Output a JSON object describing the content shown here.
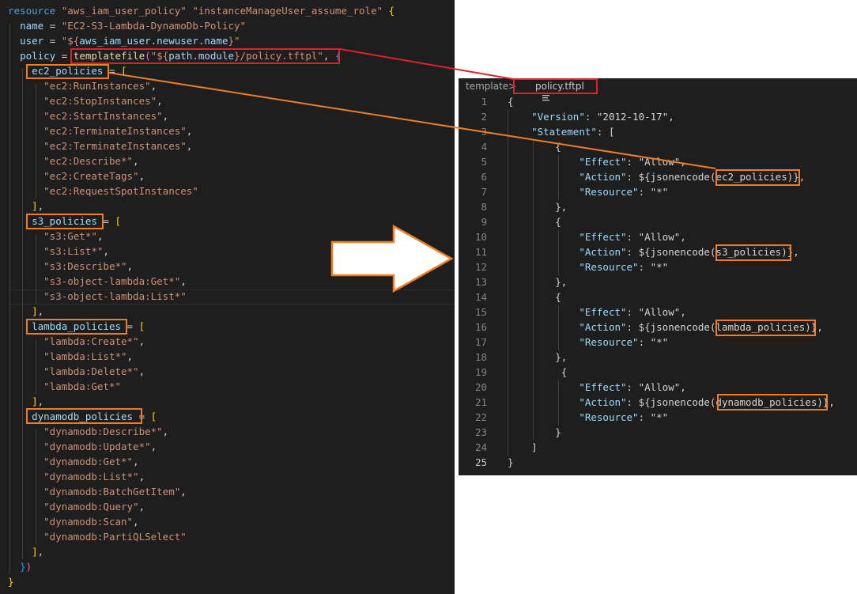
{
  "left_editor": {
    "lines": [
      [
        [
          "kw",
          "resource "
        ],
        [
          "s",
          "\"aws_iam_user_policy\" "
        ],
        [
          "s",
          "\"instanceManageUser_assume_role\" "
        ],
        [
          "p1",
          "{"
        ]
      ],
      [
        [
          "pl",
          "  "
        ],
        [
          "k",
          "name"
        ],
        [
          "pl",
          " = "
        ],
        [
          "s",
          "\"EC2-S3-Lambda-DynamoDb-Policy\""
        ]
      ],
      [
        [
          "pl",
          "  "
        ],
        [
          "k",
          "user"
        ],
        [
          "pl",
          " = "
        ],
        [
          "s",
          "\"${"
        ],
        [
          "k",
          "aws_iam_user.newuser.name"
        ],
        [
          "s",
          "}\""
        ]
      ],
      [
        [
          "pl",
          "  "
        ],
        [
          "k",
          "policy"
        ],
        [
          "pl",
          " = "
        ],
        [
          "fn",
          "templatefile"
        ],
        [
          "p2",
          "("
        ],
        [
          "s",
          "\"${"
        ],
        [
          "k",
          "path.module"
        ],
        [
          "s",
          "}/policy.tftpl\""
        ],
        [
          "pl",
          ", "
        ],
        [
          "p3",
          "{"
        ]
      ],
      [
        [
          "pl",
          "    "
        ],
        [
          "k",
          "ec2_policies"
        ],
        [
          "pl",
          " = "
        ],
        [
          "p1",
          "["
        ]
      ],
      [
        [
          "pl",
          "      "
        ],
        [
          "s",
          "\"ec2:RunInstances\""
        ],
        [
          "pl",
          ","
        ]
      ],
      [
        [
          "pl",
          "      "
        ],
        [
          "s",
          "\"ec2:StopInstances\""
        ],
        [
          "pl",
          ","
        ]
      ],
      [
        [
          "pl",
          "      "
        ],
        [
          "s",
          "\"ec2:StartInstances\""
        ],
        [
          "pl",
          ","
        ]
      ],
      [
        [
          "pl",
          "      "
        ],
        [
          "s",
          "\"ec2:TerminateInstances\""
        ],
        [
          "pl",
          ","
        ]
      ],
      [
        [
          "pl",
          "      "
        ],
        [
          "s",
          "\"ec2:TerminateInstances\""
        ],
        [
          "pl",
          ","
        ]
      ],
      [
        [
          "pl",
          "      "
        ],
        [
          "s",
          "\"ec2:Describe*\""
        ],
        [
          "pl",
          ","
        ]
      ],
      [
        [
          "pl",
          "      "
        ],
        [
          "s",
          "\"ec2:CreateTags\""
        ],
        [
          "pl",
          ","
        ]
      ],
      [
        [
          "pl",
          "      "
        ],
        [
          "s",
          "\"ec2:RequestSpotInstances\""
        ]
      ],
      [
        [
          "pl",
          "    "
        ],
        [
          "p1",
          "]"
        ],
        [
          "pl",
          ","
        ]
      ],
      [
        [
          "pl",
          "    "
        ],
        [
          "k",
          "s3_policies"
        ],
        [
          "pl",
          " = "
        ],
        [
          "p1",
          "["
        ]
      ],
      [
        [
          "pl",
          "      "
        ],
        [
          "s",
          "\"s3:Get*\""
        ],
        [
          "pl",
          ","
        ]
      ],
      [
        [
          "pl",
          "      "
        ],
        [
          "s",
          "\"s3:List*\""
        ],
        [
          "pl",
          ","
        ]
      ],
      [
        [
          "pl",
          "      "
        ],
        [
          "s",
          "\"s3:Describe*\""
        ],
        [
          "pl",
          ","
        ]
      ],
      [
        [
          "pl",
          "      "
        ],
        [
          "s",
          "\"s3-object-lambda:Get*\""
        ],
        [
          "pl",
          ","
        ]
      ],
      [
        [
          "pl",
          "      "
        ],
        [
          "s",
          "\"s3-object-lambda:List*\""
        ]
      ],
      [
        [
          "pl",
          "    "
        ],
        [
          "p1",
          "]"
        ],
        [
          "pl",
          ","
        ]
      ],
      [
        [
          "pl",
          "    "
        ],
        [
          "k",
          "lambda_policies"
        ],
        [
          "pl",
          " = "
        ],
        [
          "p1",
          "["
        ]
      ],
      [
        [
          "pl",
          "      "
        ],
        [
          "s",
          "\"lambda:Create*\""
        ],
        [
          "pl",
          ","
        ]
      ],
      [
        [
          "pl",
          "      "
        ],
        [
          "s",
          "\"lambda:List*\""
        ],
        [
          "pl",
          ","
        ]
      ],
      [
        [
          "pl",
          "      "
        ],
        [
          "s",
          "\"lambda:Delete*\""
        ],
        [
          "pl",
          ","
        ]
      ],
      [
        [
          "pl",
          "      "
        ],
        [
          "s",
          "\"lambda:Get*\""
        ]
      ],
      [
        [
          "pl",
          "    "
        ],
        [
          "p1",
          "]"
        ],
        [
          "pl",
          ","
        ]
      ],
      [
        [
          "pl",
          "    "
        ],
        [
          "k",
          "dynamodb_policies"
        ],
        [
          "pl",
          " = "
        ],
        [
          "p1",
          "["
        ]
      ],
      [
        [
          "pl",
          "      "
        ],
        [
          "s",
          "\"dynamodb:Describe*\""
        ],
        [
          "pl",
          ","
        ]
      ],
      [
        [
          "pl",
          "      "
        ],
        [
          "s",
          "\"dynamodb:Update*\""
        ],
        [
          "pl",
          ","
        ]
      ],
      [
        [
          "pl",
          "      "
        ],
        [
          "s",
          "\"dynamodb:Get*\""
        ],
        [
          "pl",
          ","
        ]
      ],
      [
        [
          "pl",
          "      "
        ],
        [
          "s",
          "\"dynamodb:List*\""
        ],
        [
          "pl",
          ","
        ]
      ],
      [
        [
          "pl",
          "      "
        ],
        [
          "s",
          "\"dynamodb:BatchGetItem\""
        ],
        [
          "pl",
          ","
        ]
      ],
      [
        [
          "pl",
          "      "
        ],
        [
          "s",
          "\"dynamodb:Query\""
        ],
        [
          "pl",
          ","
        ]
      ],
      [
        [
          "pl",
          "      "
        ],
        [
          "s",
          "\"dynamodb:Scan\""
        ],
        [
          "pl",
          ","
        ]
      ],
      [
        [
          "pl",
          "      "
        ],
        [
          "s",
          "\"dynamodb:PartiQLSelect\""
        ]
      ],
      [
        [
          "pl",
          "    "
        ],
        [
          "p1",
          "]"
        ],
        [
          "pl",
          ","
        ]
      ],
      [
        [
          "pl",
          "  "
        ],
        [
          "p3",
          "}"
        ],
        [
          "p2",
          ")"
        ]
      ],
      [
        [
          "p1",
          "}"
        ]
      ]
    ]
  },
  "right_panel": {
    "breadcrumb": {
      "folder": "template",
      "separator": ">",
      "file_icon": "file-lines-icon",
      "file": "policy.tftpl"
    },
    "active_line": 25,
    "lines": [
      [
        [
          "pl",
          "{"
        ]
      ],
      [
        [
          "pl",
          "    "
        ],
        [
          "k",
          "\"Version\""
        ],
        [
          "pl",
          ": "
        ],
        [
          "pl",
          "\"2012-10-17\""
        ],
        [
          "pl",
          ","
        ]
      ],
      [
        [
          "pl",
          "    "
        ],
        [
          "k",
          "\"Statement\""
        ],
        [
          "pl",
          ": ["
        ]
      ],
      [
        [
          "pl",
          "        {"
        ]
      ],
      [
        [
          "pl",
          "            "
        ],
        [
          "k",
          "\"Effect\""
        ],
        [
          "pl",
          ": \"Allow\","
        ]
      ],
      [
        [
          "pl",
          "            "
        ],
        [
          "k",
          "\"Action\""
        ],
        [
          "pl",
          ": ${jsonencode(ec2_policies)},"
        ]
      ],
      [
        [
          "pl",
          "            "
        ],
        [
          "k",
          "\"Resource\""
        ],
        [
          "pl",
          ": \"*\""
        ]
      ],
      [
        [
          "pl",
          "        },"
        ]
      ],
      [
        [
          "pl",
          "        {"
        ]
      ],
      [
        [
          "pl",
          "            "
        ],
        [
          "k",
          "\"Effect\""
        ],
        [
          "pl",
          ": \"Allow\","
        ]
      ],
      [
        [
          "pl",
          "            "
        ],
        [
          "k",
          "\"Action\""
        ],
        [
          "pl",
          ": ${jsonencode(s3_policies)},"
        ]
      ],
      [
        [
          "pl",
          "            "
        ],
        [
          "k",
          "\"Resource\""
        ],
        [
          "pl",
          ": \"*\""
        ]
      ],
      [
        [
          "pl",
          "        },"
        ]
      ],
      [
        [
          "pl",
          "        {"
        ]
      ],
      [
        [
          "pl",
          "            "
        ],
        [
          "k",
          "\"Effect\""
        ],
        [
          "pl",
          ": \"Allow\","
        ]
      ],
      [
        [
          "pl",
          "            "
        ],
        [
          "k",
          "\"Action\""
        ],
        [
          "pl",
          ": ${jsonencode(lambda_policies)},"
        ]
      ],
      [
        [
          "pl",
          "            "
        ],
        [
          "k",
          "\"Resource\""
        ],
        [
          "pl",
          ": \"*\""
        ]
      ],
      [
        [
          "pl",
          "        },"
        ]
      ],
      [
        [
          "pl",
          "         {"
        ]
      ],
      [
        [
          "pl",
          "            "
        ],
        [
          "k",
          "\"Effect\""
        ],
        [
          "pl",
          ": \"Allow\","
        ]
      ],
      [
        [
          "pl",
          "            "
        ],
        [
          "k",
          "\"Action\""
        ],
        [
          "pl",
          ": ${jsonencode(dynamodb_policies)},"
        ]
      ],
      [
        [
          "pl",
          "            "
        ],
        [
          "k",
          "\"Resource\""
        ],
        [
          "pl",
          ": \"*\""
        ]
      ],
      [
        [
          "pl",
          "        }"
        ]
      ],
      [
        [
          "pl",
          "    ]"
        ]
      ],
      [
        [
          "pl",
          "}"
        ]
      ]
    ]
  },
  "colors": {
    "editor_bg": "#1e1e1e",
    "highlight_orange": "#f07d22",
    "highlight_red": "#e0202a"
  }
}
